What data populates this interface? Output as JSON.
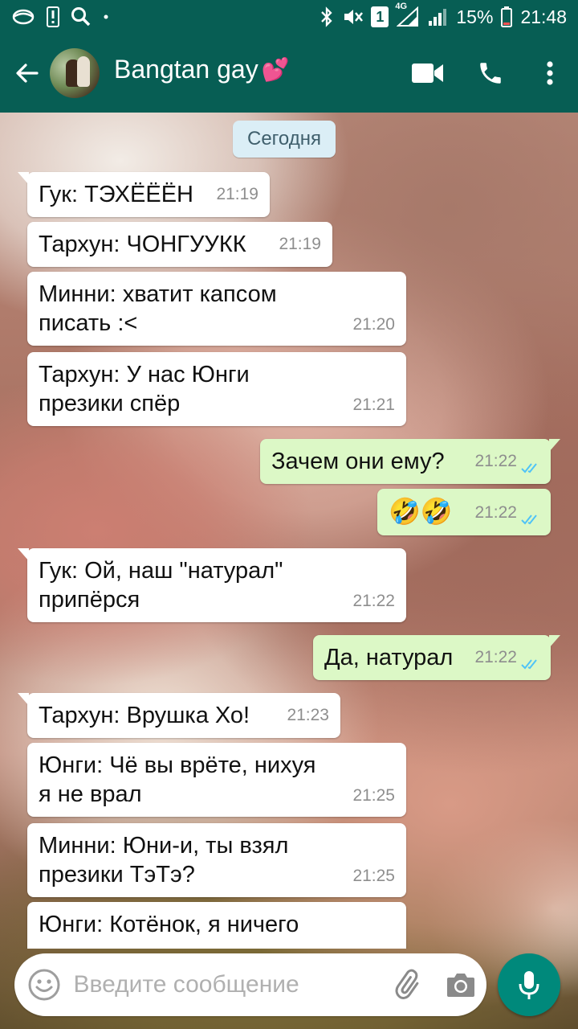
{
  "status_bar": {
    "battery_percent": "15%",
    "time": "21:48",
    "sim_badge": "1",
    "network_type": "4G"
  },
  "header": {
    "chat_name": "Bangtan gay",
    "heart_emoji": "💕"
  },
  "date_chip": "Сегодня",
  "messages": [
    {
      "dir": "in",
      "text": "Гук: ТЭХЁЁЁН",
      "time": "21:19"
    },
    {
      "dir": "in",
      "text": "Тархун: ЧОНГУУКК",
      "time": "21:19"
    },
    {
      "dir": "in",
      "text": "Минни: хватит капсом\nписать :<",
      "time": "21:20"
    },
    {
      "dir": "in",
      "text": "Тархун: У нас Юнги\nпрезики спёр",
      "time": "21:21"
    },
    {
      "dir": "out",
      "text": "Зачем они ему?",
      "time": "21:22",
      "read": true
    },
    {
      "dir": "out",
      "text": "🤣🤣",
      "time": "21:22",
      "read": true
    },
    {
      "dir": "in",
      "text": "Гук: Ой, наш \"натурал\"\nприпёрся",
      "time": "21:22"
    },
    {
      "dir": "out",
      "text": "Да, натурал",
      "time": "21:22",
      "read": true
    },
    {
      "dir": "in",
      "text": "Тархун: Врушка Хо!",
      "time": "21:23"
    },
    {
      "dir": "in",
      "text": "Юнги: Чё вы врёте, нихуя\nя не врал",
      "time": "21:25"
    },
    {
      "dir": "in",
      "text": "Минни: Юни-и, ты взял\nпрезики ТэТэ?",
      "time": "21:25"
    },
    {
      "dir": "in",
      "text": "Юнги: Котёнок, я ничего",
      "time": ""
    }
  ],
  "input": {
    "placeholder": "Введите сообщение",
    "value": ""
  },
  "colors": {
    "header_bg": "#075e54",
    "incoming_bubble": "#ffffff",
    "outgoing_bubble": "#dcf8c6",
    "mic_button": "#00897b",
    "read_ticks": "#4fc3f7"
  },
  "icons": [
    "back-arrow-icon",
    "video-call-icon",
    "phone-icon",
    "more-vert-icon",
    "emoji-icon",
    "attach-icon",
    "camera-icon",
    "mic-icon"
  ]
}
